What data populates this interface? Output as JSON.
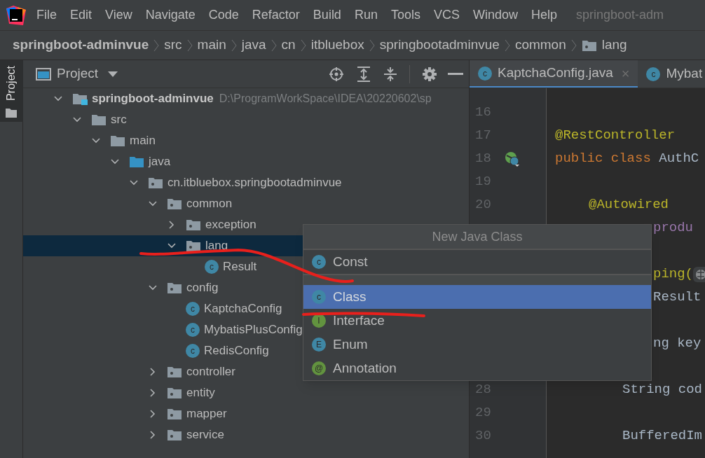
{
  "menu_bar": {
    "items": [
      "File",
      "Edit",
      "View",
      "Navigate",
      "Code",
      "Refactor",
      "Build",
      "Run",
      "Tools",
      "VCS",
      "Window",
      "Help"
    ],
    "title": "springboot-adm"
  },
  "breadcrumbs": [
    {
      "label": "springboot-adminvue",
      "kind": "module"
    },
    {
      "label": "src",
      "kind": "plain"
    },
    {
      "label": "main",
      "kind": "plain"
    },
    {
      "label": "java",
      "kind": "plain"
    },
    {
      "label": "cn",
      "kind": "plain"
    },
    {
      "label": "itbluebox",
      "kind": "plain"
    },
    {
      "label": "springbootadminvue",
      "kind": "plain"
    },
    {
      "label": "common",
      "kind": "plain"
    },
    {
      "label": "lang",
      "kind": "folder"
    }
  ],
  "side_strip": {
    "tab": "Project"
  },
  "project_panel": {
    "title": "Project",
    "tree": [
      {
        "label": "springboot-adminvue",
        "path": "D:\\ProgramWorkSpace\\IDEA\\20220602\\sp",
        "kind": "module",
        "expanded": true,
        "selected": false,
        "children": [
          {
            "label": "src",
            "kind": "folder",
            "expanded": true,
            "selected": false,
            "children": [
              {
                "label": "main",
                "kind": "folder",
                "expanded": true,
                "selected": false,
                "children": [
                  {
                    "label": "java",
                    "kind": "source",
                    "expanded": true,
                    "selected": false,
                    "children": [
                      {
                        "label": "cn.itbluebox.springbootadminvue",
                        "kind": "package",
                        "expanded": true,
                        "selected": false,
                        "children": [
                          {
                            "label": "common",
                            "kind": "package",
                            "expanded": true,
                            "selected": false,
                            "children": [
                              {
                                "label": "exception",
                                "kind": "package",
                                "expanded": false,
                                "selected": false
                              },
                              {
                                "label": "lang",
                                "kind": "package",
                                "expanded": true,
                                "selected": true,
                                "children": [
                                  {
                                    "label": "Result",
                                    "kind": "class",
                                    "badge": "c",
                                    "selected": false
                                  }
                                ]
                              }
                            ]
                          },
                          {
                            "label": "config",
                            "kind": "package",
                            "expanded": true,
                            "selected": false,
                            "children": [
                              {
                                "label": "KaptchaConfig",
                                "kind": "class",
                                "badge": "c",
                                "selected": false
                              },
                              {
                                "label": "MybatisPlusConfig",
                                "kind": "class",
                                "badge": "c",
                                "selected": false
                              },
                              {
                                "label": "RedisConfig",
                                "kind": "class",
                                "badge": "c",
                                "selected": false
                              }
                            ]
                          },
                          {
                            "label": "controller",
                            "kind": "package",
                            "expanded": false,
                            "selected": false
                          },
                          {
                            "label": "entity",
                            "kind": "package",
                            "expanded": false,
                            "selected": false
                          },
                          {
                            "label": "mapper",
                            "kind": "package",
                            "expanded": false,
                            "selected": false
                          },
                          {
                            "label": "service",
                            "kind": "package",
                            "expanded": false,
                            "selected": false
                          }
                        ]
                      }
                    ]
                  }
                ]
              }
            ]
          }
        ]
      }
    ]
  },
  "editor": {
    "tabs": [
      {
        "label": "KaptchaConfig.java",
        "badge": "c",
        "close": "×",
        "selected": true
      },
      {
        "label": "Mybat",
        "badge": "c",
        "selected": false
      }
    ],
    "lines": [
      {
        "number": "16",
        "kind": "normal"
      },
      {
        "number": "17",
        "kind": "normal",
        "tokens": [
          {
            "text": "@RestController",
            "kind": "annotation"
          }
        ]
      },
      {
        "number": "18",
        "kind": "normal",
        "bean": true,
        "tokens": [
          {
            "text": "public class ",
            "kind": "keyword"
          },
          {
            "text": "AuthC",
            "kind": "plain"
          }
        ]
      },
      {
        "number": "19",
        "kind": "normal"
      },
      {
        "number": "20",
        "kind": "indented",
        "tokens": [
          {
            "text": "@Autowired",
            "kind": "annotation"
          }
        ]
      },
      {
        "kind": "clipped",
        "tokens": [
          {
            "text": "produ",
            "kind": "field"
          }
        ]
      },
      {
        "kind": "clipped"
      },
      {
        "kind": "clipped",
        "inlay": true,
        "tokens": [
          {
            "text": "ping(",
            "kind": "annotation"
          }
        ]
      },
      {
        "kind": "clipped",
        "tokens": [
          {
            "text": "Result ",
            "kind": "plain"
          }
        ]
      },
      {
        "kind": "clipped"
      },
      {
        "kind": "clipped",
        "tokens": [
          {
            "text": "ng key",
            "kind": "plain"
          }
        ]
      },
      {
        "kind": "clipped"
      },
      {
        "number": "28",
        "kind": "nested",
        "tokens": [
          {
            "text": "String cod",
            "kind": "plain"
          }
        ]
      },
      {
        "number": "29",
        "kind": "normal"
      },
      {
        "number": "30",
        "kind": "nested",
        "tokens": [
          {
            "text": "BufferedIm",
            "kind": "plain"
          }
        ]
      }
    ]
  },
  "popup": {
    "title": "New Java Class",
    "items": [
      {
        "label": "Const",
        "badge": "c",
        "kind": "class",
        "selected": false
      },
      {
        "label": "Class",
        "badge": "c",
        "kind": "class",
        "selected": true
      },
      {
        "label": "Interface",
        "badge": "I",
        "kind": "interface",
        "selected": false
      },
      {
        "label": "Enum",
        "badge": "E",
        "kind": "enum",
        "selected": false
      },
      {
        "label": "Annotation",
        "badge": "@",
        "kind": "annotation",
        "selected": false
      }
    ]
  }
}
